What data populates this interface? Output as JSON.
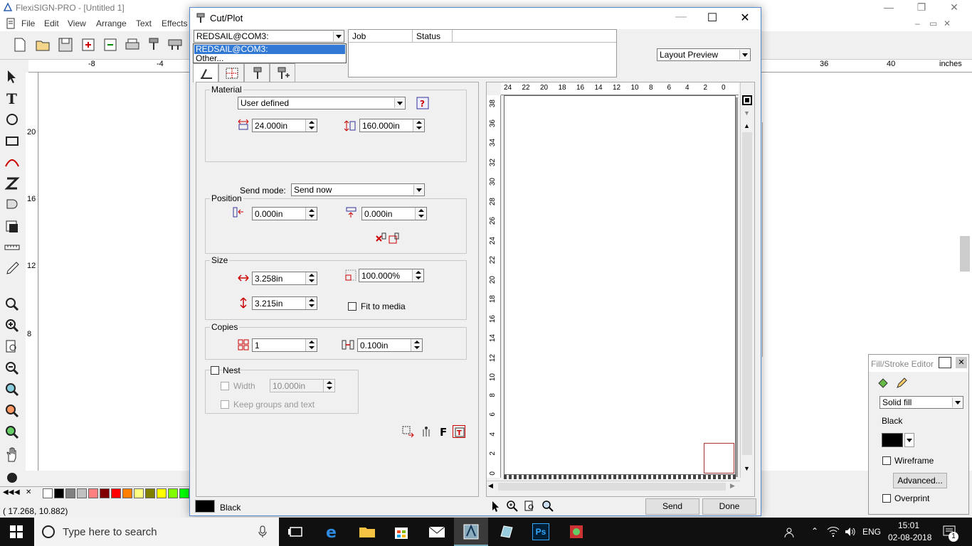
{
  "app": {
    "title": "FlexiSIGN-PRO - [Untitled 1]",
    "menu": [
      "File",
      "Edit",
      "View",
      "Arrange",
      "Text",
      "Effects"
    ],
    "ruler_h_labels": [
      "-8",
      "-4",
      "36",
      "40"
    ],
    "ruler_units": "inches",
    "ruler_v_labels": [
      "20",
      "16",
      "12",
      "8"
    ],
    "coords": "( 17.268,    10.882)",
    "palette_colors": [
      "#ffffff",
      "#000000",
      "#808080",
      "#c0c0c0",
      "#ff8080",
      "#800000",
      "#ff0000",
      "#ff8000",
      "#ffff80",
      "#808000",
      "#ffff00",
      "#80ff00",
      "#00ff00"
    ]
  },
  "dialog": {
    "title": "Cut/Plot",
    "device_combo": "REDSAIL@COM3:",
    "dropdown_items": [
      "REDSAIL@COM3:",
      "Other..."
    ],
    "job_cols": [
      "Job",
      "Status"
    ],
    "view_combo": "Layout Preview",
    "material": {
      "legend": "Material",
      "value": "User defined",
      "width": "24.000in",
      "length": "160.000in"
    },
    "send_mode": {
      "label": "Send mode:",
      "value": "Send now"
    },
    "position": {
      "legend": "Position",
      "x": "0.000in",
      "y": "0.000in"
    },
    "size": {
      "legend": "Size",
      "width": "3.258in",
      "height": "3.215in",
      "scale": "100.000%",
      "fit_label": "Fit to media"
    },
    "copies": {
      "legend": "Copies",
      "count": "1",
      "spacing": "0.100in"
    },
    "nest": {
      "label": "Nest",
      "width_label": "Width",
      "width_value": "10.000in",
      "keep_label": "Keep groups and text"
    },
    "color_label": "Black",
    "send_button": "Send",
    "done_button": "Done",
    "preview_h_labels": [
      "24",
      "22",
      "20",
      "18",
      "16",
      "14",
      "12",
      "10",
      "8",
      "6",
      "4",
      "2",
      "0"
    ],
    "preview_v_labels": [
      "38",
      "36",
      "34",
      "32",
      "30",
      "28",
      "26",
      "24",
      "22",
      "20",
      "18",
      "16",
      "14",
      "12",
      "10",
      "8",
      "6",
      "4",
      "2",
      "0"
    ]
  },
  "fill_stroke": {
    "title": "Fill/Stroke Editor",
    "fill_combo": "Solid fill",
    "color_name": "Black",
    "wireframe": "Wireframe",
    "advanced": "Advanced...",
    "overprint": "Overprint"
  },
  "taskbar": {
    "search_placeholder": "Type here to search",
    "lang": "ENG",
    "time": "15:01",
    "date": "02-08-2018",
    "notif_count": "1"
  }
}
